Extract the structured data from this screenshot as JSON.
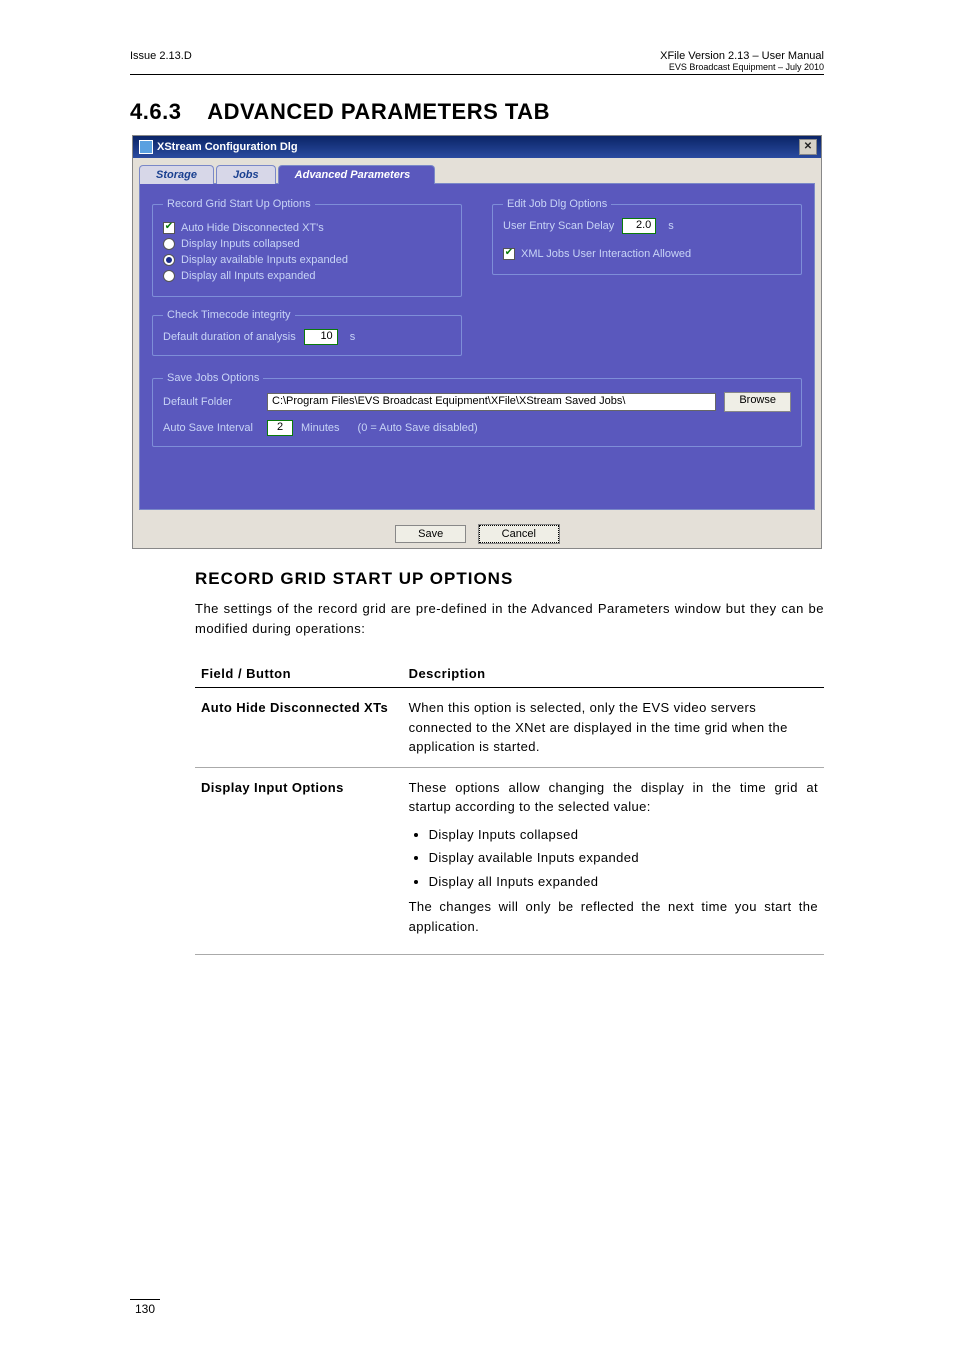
{
  "header": {
    "left": "Issue 2.13.D",
    "right_main": "XFile Version 2.13 – User Manual",
    "right_sub": "EVS Broadcast Equipment – July 2010"
  },
  "section_number": "4.6.3",
  "section_title": "ADVANCED PARAMETERS TAB",
  "dialog": {
    "title": "XStream Configuration Dlg",
    "close_glyph": "✕",
    "tabs": {
      "storage": "Storage",
      "jobs": "Jobs",
      "advanced": "Advanced Parameters"
    },
    "record_grid": {
      "legend": "Record Grid Start Up Options",
      "auto_hide": "Auto Hide Disconnected XT's",
      "opt_collapsed": "Display Inputs collapsed",
      "opt_avail": "Display available Inputs expanded",
      "opt_all": "Display all Inputs expanded"
    },
    "edit_job": {
      "legend": "Edit Job Dlg Options",
      "scan_delay_label": "User Entry Scan Delay",
      "scan_delay_value": "2.0",
      "scan_delay_unit": "s",
      "xml_allowed": "XML Jobs User Interaction Allowed"
    },
    "timecode": {
      "legend": "Check Timecode integrity",
      "duration_label": "Default duration of analysis",
      "duration_value": "10",
      "duration_unit": "s"
    },
    "save_jobs": {
      "legend": "Save Jobs Options",
      "folder_label": "Default Folder",
      "folder_value": "C:\\Program Files\\EVS Broadcast Equipment\\XFile\\XStream Saved Jobs\\",
      "browse": "Browse",
      "interval_label": "Auto Save Interval",
      "interval_value": "2",
      "interval_unit": "Minutes",
      "interval_hint": "(0 = Auto Save disabled)"
    },
    "buttons": {
      "save": "Save",
      "cancel": "Cancel"
    }
  },
  "subsection_title": "RECORD GRID START UP OPTIONS",
  "intro_para": "The settings of the record grid are pre-defined in the Advanced Parameters window but they can be modified during operations:",
  "table": {
    "col1": "Field / Button",
    "col2": "Description",
    "rows": [
      {
        "field": "Auto Hide Disconnected XTs",
        "desc": "When this option is selected, only the EVS video servers connected to the XNet are displayed in the time grid when the application is started."
      },
      {
        "field": "Display Input Options",
        "desc_intro": "These options allow changing the display in the time grid at startup according to the selected value:",
        "bullets": [
          "Display Inputs collapsed",
          "Display available Inputs expanded",
          "Display all Inputs expanded"
        ],
        "desc_outro": "The changes will only be reflected the next time you start the application."
      }
    ]
  },
  "page_number": "130"
}
